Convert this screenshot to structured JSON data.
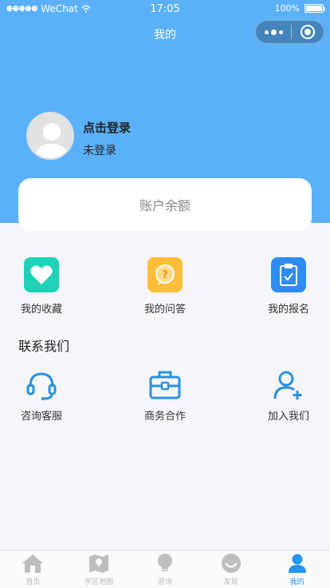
{
  "status_bar": {
    "carrier": "WeChat",
    "time": "17:05",
    "battery": "100%"
  },
  "nav": {
    "title": "我的"
  },
  "profile": {
    "login_title": "点击登录",
    "login_status": "未登录"
  },
  "balance": {
    "label": "账户余额"
  },
  "features": [
    {
      "label": "我的收藏",
      "icon": "heart-icon",
      "color": "#1fd3b8"
    },
    {
      "label": "我的问答",
      "icon": "question-bubble-icon",
      "color": "#ffbe3a"
    },
    {
      "label": "我的报名",
      "icon": "clipboard-icon",
      "color": "#2f8cf2"
    }
  ],
  "contact": {
    "title": "联系我们",
    "items": [
      {
        "label": "咨询客服",
        "icon": "headset-icon"
      },
      {
        "label": "商务合作",
        "icon": "briefcase-icon"
      },
      {
        "label": "加入我们",
        "icon": "add-user-icon"
      }
    ]
  },
  "tabbar": {
    "items": [
      {
        "label": "首页",
        "icon": "home-icon"
      },
      {
        "label": "学区地图",
        "icon": "map-icon"
      },
      {
        "label": "咨询",
        "icon": "bulb-icon"
      },
      {
        "label": "发现",
        "icon": "discover-icon"
      },
      {
        "label": "我的",
        "icon": "user-icon"
      }
    ],
    "active_index": 4,
    "active_color": "#2196f3",
    "inactive_color": "#b8b8b8"
  },
  "colors": {
    "header": "#5bb1f9",
    "accent": "#2196f3"
  }
}
